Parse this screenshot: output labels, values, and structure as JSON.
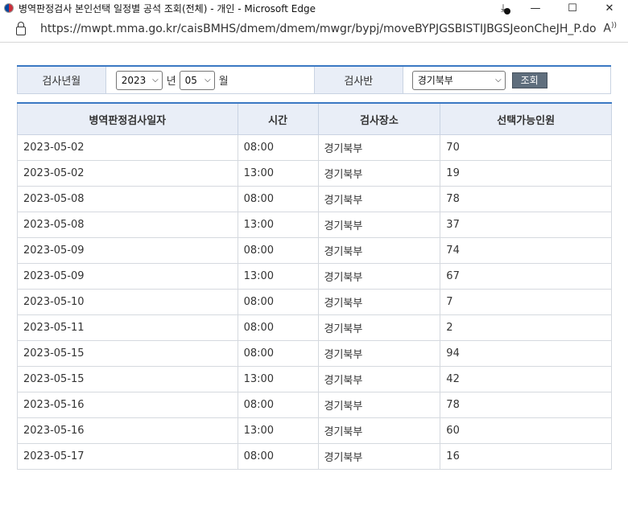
{
  "window": {
    "title": "병역판정검사 본인선택 일정별 공석 조회(전체) - 개인 - Microsoft Edge",
    "url": "https://mwpt.mma.go.kr/caisBMHS/dmem/dmem/mwgr/bypj/moveBYPJGSBISTIJBGSJeonCheJH_P.do"
  },
  "search": {
    "year_label": "검사년월",
    "year_value": "2023",
    "year_unit": "년",
    "month_value": "05",
    "month_unit": "월",
    "ban_label": "검사반",
    "ban_value": "경기북부",
    "query_label": "조회"
  },
  "table": {
    "headers": [
      "병역판정검사일자",
      "시간",
      "검사장소",
      "선택가능인원"
    ],
    "rows": [
      [
        "2023-05-02",
        "08:00",
        "경기북부",
        "70"
      ],
      [
        "2023-05-02",
        "13:00",
        "경기북부",
        "19"
      ],
      [
        "2023-05-08",
        "08:00",
        "경기북부",
        "78"
      ],
      [
        "2023-05-08",
        "13:00",
        "경기북부",
        "37"
      ],
      [
        "2023-05-09",
        "08:00",
        "경기북부",
        "74"
      ],
      [
        "2023-05-09",
        "13:00",
        "경기북부",
        "67"
      ],
      [
        "2023-05-10",
        "08:00",
        "경기북부",
        "7"
      ],
      [
        "2023-05-11",
        "08:00",
        "경기북부",
        "2"
      ],
      [
        "2023-05-15",
        "08:00",
        "경기북부",
        "94"
      ],
      [
        "2023-05-15",
        "13:00",
        "경기북부",
        "42"
      ],
      [
        "2023-05-16",
        "08:00",
        "경기북부",
        "78"
      ],
      [
        "2023-05-16",
        "13:00",
        "경기북부",
        "60"
      ],
      [
        "2023-05-17",
        "08:00",
        "경기북부",
        "16"
      ]
    ]
  }
}
